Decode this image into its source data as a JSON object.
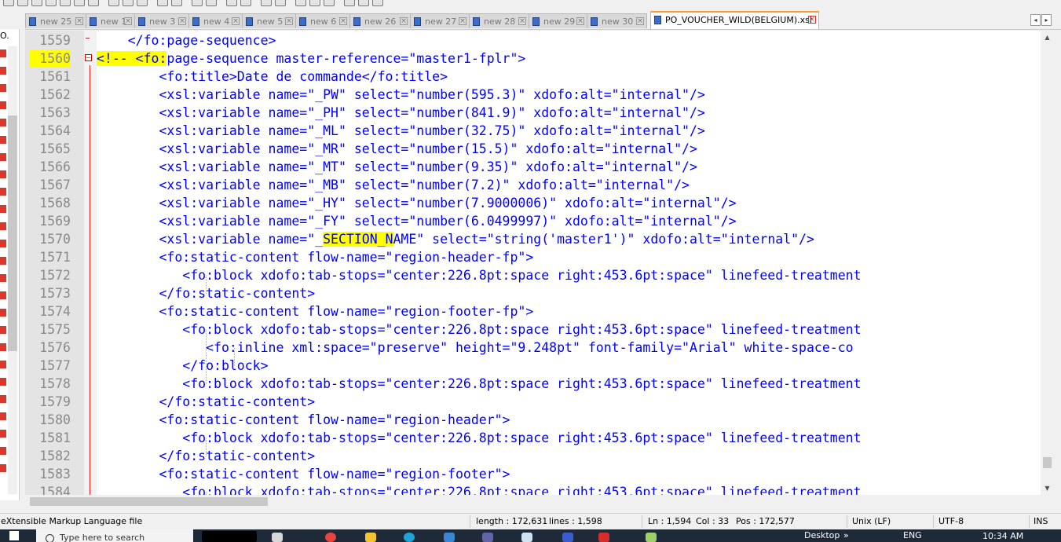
{
  "tabs": [
    {
      "label": "new 25",
      "active": false
    },
    {
      "label": "new 1",
      "active": false
    },
    {
      "label": "new 3",
      "active": false
    },
    {
      "label": "new 4",
      "active": false
    },
    {
      "label": "new 5",
      "active": false
    },
    {
      "label": "new 6",
      "active": false
    },
    {
      "label": "new 26",
      "active": false
    },
    {
      "label": "new 27",
      "active": false
    },
    {
      "label": "new 28",
      "active": false
    },
    {
      "label": "new 29",
      "active": false
    },
    {
      "label": "new 30",
      "active": false
    },
    {
      "label": "PO_VOUCHER_WILD(BELGIUM).xsl",
      "active": true
    }
  ],
  "tab_nav": {
    "prev": "◂",
    "next": "▸"
  },
  "left_panel": {
    "top_text": "O."
  },
  "editor": {
    "lines": [
      {
        "num": "1559",
        "text": "    </fo:page-sequence>"
      },
      {
        "num": "1560",
        "pre": "",
        "hl": "<!-- <fo:",
        "post": "page-sequence master-reference=\"master1-fplr\">"
      },
      {
        "num": "1561",
        "text": "        <fo:title>Date de commande</fo:title>"
      },
      {
        "num": "1562",
        "text": "        <xsl:variable name=\"_PW\" select=\"number(595.3)\" xdofo:alt=\"internal\"/>"
      },
      {
        "num": "1563",
        "text": "        <xsl:variable name=\"_PH\" select=\"number(841.9)\" xdofo:alt=\"internal\"/>"
      },
      {
        "num": "1564",
        "text": "        <xsl:variable name=\"_ML\" select=\"number(32.75)\" xdofo:alt=\"internal\"/>"
      },
      {
        "num": "1565",
        "text": "        <xsl:variable name=\"_MR\" select=\"number(15.5)\" xdofo:alt=\"internal\"/>"
      },
      {
        "num": "1566",
        "text": "        <xsl:variable name=\"_MT\" select=\"number(9.35)\" xdofo:alt=\"internal\"/>"
      },
      {
        "num": "1567",
        "text": "        <xsl:variable name=\"_MB\" select=\"number(7.2)\" xdofo:alt=\"internal\"/>"
      },
      {
        "num": "1568",
        "text": "        <xsl:variable name=\"_HY\" select=\"number(7.9000006)\" xdofo:alt=\"internal\"/>"
      },
      {
        "num": "1569",
        "text": "        <xsl:variable name=\"_FY\" select=\"number(6.0499997)\" xdofo:alt=\"internal\"/>"
      },
      {
        "num": "1570",
        "pre": "        <xsl:variable name=\"_",
        "hl": "SECTION_N",
        "post": "AME\" select=\"string('master1')\" xdofo:alt=\"internal\"/>"
      },
      {
        "num": "1571",
        "text": "        <fo:static-content flow-name=\"region-header-fp\">"
      },
      {
        "num": "1572",
        "text": "           <fo:block xdofo:tab-stops=\"center:226.8pt:space right:453.6pt:space\" linefeed-treatment"
      },
      {
        "num": "1573",
        "text": "        </fo:static-content>"
      },
      {
        "num": "1574",
        "text": "        <fo:static-content flow-name=\"region-footer-fp\">"
      },
      {
        "num": "1575",
        "text": "           <fo:block xdofo:tab-stops=\"center:226.8pt:space right:453.6pt:space\" linefeed-treatment"
      },
      {
        "num": "1576",
        "text": "              <fo:inline xml:space=\"preserve\" height=\"9.248pt\" font-family=\"Arial\" white-space-co"
      },
      {
        "num": "1577",
        "text": "           </fo:block>"
      },
      {
        "num": "1578",
        "text": "           <fo:block xdofo:tab-stops=\"center:226.8pt:space right:453.6pt:space\" linefeed-treatment"
      },
      {
        "num": "1579",
        "text": "        </fo:static-content>"
      },
      {
        "num": "1580",
        "text": "        <fo:static-content flow-name=\"region-header\">"
      },
      {
        "num": "1581",
        "text": "           <fo:block xdofo:tab-stops=\"center:226.8pt:space right:453.6pt:space\" linefeed-treatment"
      },
      {
        "num": "1582",
        "text": "        </fo:static-content>"
      },
      {
        "num": "1583",
        "text": "        <fo:static-content flow-name=\"region-footer\">"
      },
      {
        "num": "1584",
        "text": "           <fo:block xdofo:tab-stops=\"center:226.8pt:space right:453.6pt:space\" linefeed-treatment"
      }
    ]
  },
  "status": {
    "file_type": "eXtensible Markup Language file",
    "length": "length : 172,631",
    "lines": "lines : 1,598",
    "ln": "Ln : 1,594",
    "col": "Col : 33",
    "pos": "Pos : 172,577",
    "eol": "Unix (LF)",
    "encoding": "UTF-8",
    "mode": "INS"
  },
  "taskbar": {
    "search_placeholder": "Type here to search",
    "time": "10:34 AM",
    "lang": "ENG",
    "desktop": "Desktop"
  },
  "colors": {
    "tag_text": "#0000ff",
    "highlight": "#ffff00",
    "active_tab_accent": "#fa9b35",
    "fold_marker": "#e02020"
  }
}
